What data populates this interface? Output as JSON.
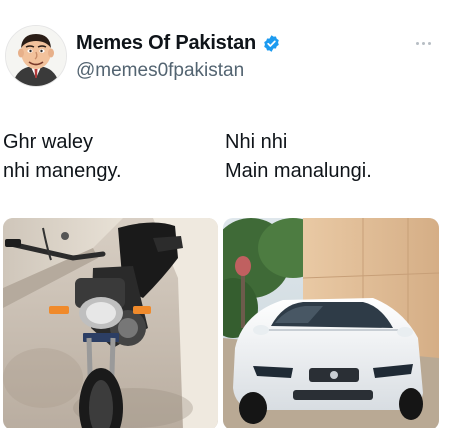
{
  "tweet": {
    "author": {
      "display_name": "Memes Of Pakistan",
      "handle": "@memes0fpakistan",
      "verified": true,
      "verified_icon": "verified-badge-icon",
      "avatar_icon": "cartoon-man-avatar"
    },
    "more_icon": "more-dots-icon",
    "caption": {
      "left": {
        "line1": "Ghr waley",
        "line2": "nhi manengy."
      },
      "right": {
        "line1": "Nhi nhi",
        "line2": "Main manalungi."
      }
    },
    "media": [
      {
        "icon": "motorcycle-photo"
      },
      {
        "icon": "white-car-photo"
      }
    ]
  },
  "colors": {
    "text": "#0f1419",
    "secondary": "#536471",
    "verified": "#1d9bf0"
  }
}
